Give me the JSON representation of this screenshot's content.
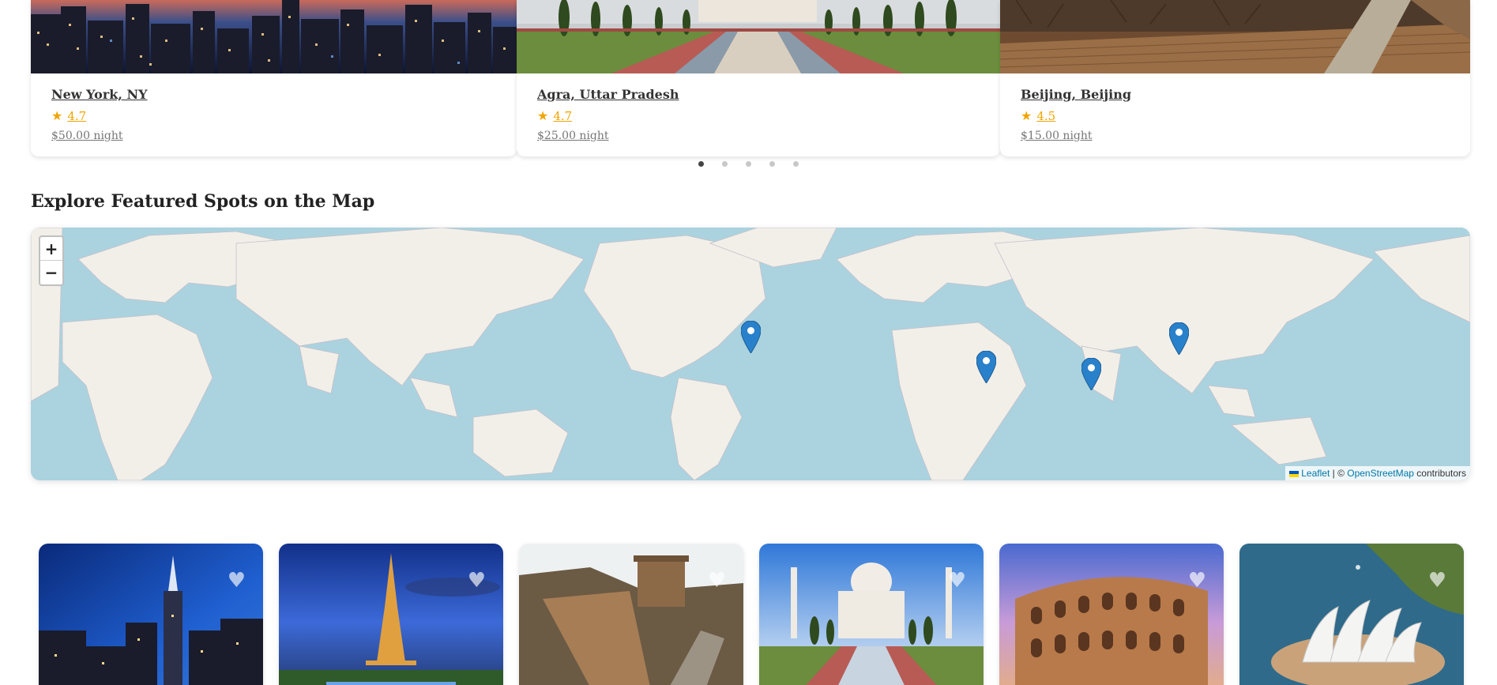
{
  "carousel": {
    "cards": [
      {
        "title": "New York, NY",
        "rating": "4.7",
        "price": "$50.00 night",
        "image": "new-york-city-night-skyline"
      },
      {
        "title": "Agra, Uttar Pradesh",
        "rating": "4.7",
        "price": "$25.00 night",
        "image": "taj-mahal-reflecting-pool"
      },
      {
        "title": "Beijing, Beijing",
        "rating": "4.5",
        "price": "$15.00 night",
        "image": "great-wall-of-china"
      }
    ],
    "pagination_count": 5,
    "active_page": 1,
    "star_icon": "star-icon"
  },
  "map_section": {
    "title": "Explore Featured Spots on the Map",
    "zoom_in": "+",
    "zoom_out": "−",
    "attribution": {
      "leaflet": "Leaflet",
      "separator": " | © ",
      "osm": "OpenStreetMap",
      "suffix": " contributors"
    },
    "markers": [
      "New York",
      "Cairo",
      "Agra",
      "Beijing"
    ]
  },
  "featured_cards": [
    {
      "image": "empire-state-building-night",
      "favorite_icon": "heart-icon"
    },
    {
      "image": "eiffel-tower-dusk",
      "favorite_icon": "heart-icon"
    },
    {
      "image": "great-wall-watchtower",
      "favorite_icon": "heart-icon"
    },
    {
      "image": "taj-mahal",
      "favorite_icon": "heart-icon"
    },
    {
      "image": "colosseum-sunset",
      "favorite_icon": "heart-icon"
    },
    {
      "image": "sydney-opera-house",
      "favorite_icon": "heart-icon"
    }
  ],
  "colors": {
    "rating": "#f0a500",
    "map_water": "#aad3df",
    "map_land": "#f2efe9",
    "marker": "#2a81cb",
    "link": "#0078a8"
  }
}
